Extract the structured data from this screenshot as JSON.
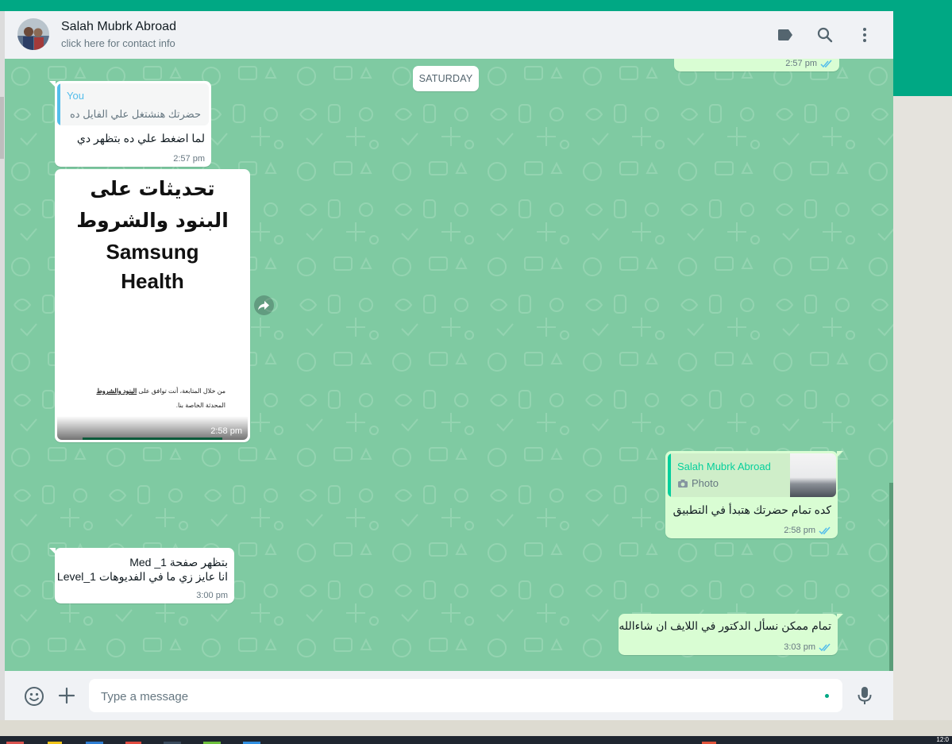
{
  "contact": {
    "name": "Salah Mubrk Abroad",
    "subtitle": "click here for contact info"
  },
  "header_icons": [
    "label-icon",
    "search-icon",
    "menu-icon"
  ],
  "day_separator": "SATURDAY",
  "messages": {
    "m0_time": "2:57 pm",
    "m1": {
      "quote_author": "You",
      "quote_text": "حضرتك هنشتغل علي الفايل ده",
      "text": "لما اضغط علي ده بتظهر دي",
      "time": "2:57 pm"
    },
    "m2": {
      "image_title_line1": "تحديثات على",
      "image_title_line2": "البنود والشروط",
      "image_title_line3": "Samsung",
      "image_title_line4": "Health",
      "image_small_line1_prefix": "من خلال المتابعة، أنت توافق على ",
      "image_small_line1_link": "البنود والشروط",
      "image_small_line2": "المحدثة الخاصة بنا.",
      "time": "2:58 pm"
    },
    "m3": {
      "quote_author": "Salah Mubrk Abroad",
      "quote_text": "Photo",
      "text": "كده تمام حضرتك هتبدأ في التطبيق",
      "time": "2:58 pm"
    },
    "m4": {
      "line1": "بتظهر صفحة 1_ Med",
      "line2": "انا عايز زي ما في الفديوهات Level_1",
      "time": "3:00 pm"
    },
    "m5": {
      "text": "تمام ممكن نسأل الدكتور في اللايف ان شاءالله",
      "time": "3:03 pm"
    }
  },
  "composer": {
    "placeholder": "Type a message"
  },
  "taskbar": {
    "clock": "12:0"
  },
  "colors": {
    "brand_green": "#00a884",
    "chat_bg": "#7fcaa2",
    "outgoing_bubble": "#d9fdd3",
    "tick_blue": "#53bdeb",
    "quote_author_green": "#06cf9c",
    "quote_bar_blue": "#53bdeb"
  }
}
